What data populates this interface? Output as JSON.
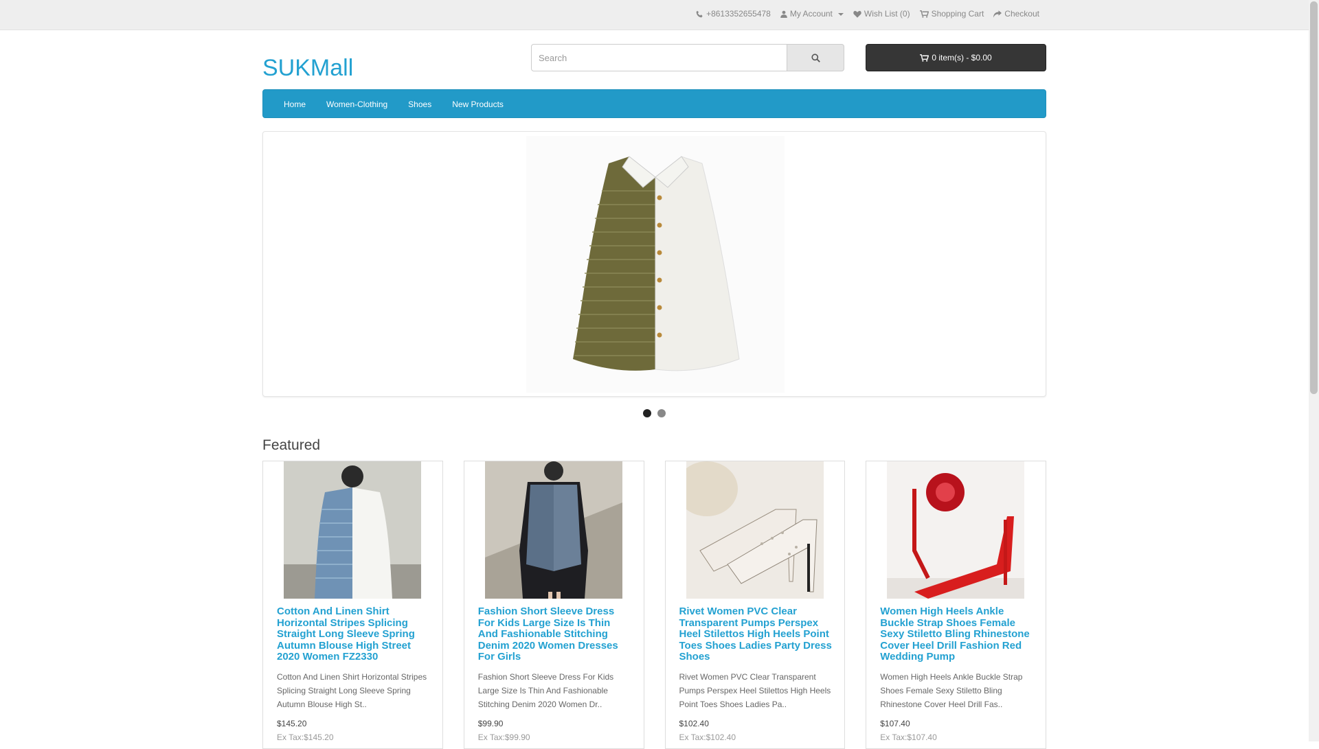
{
  "topbar": {
    "phone": "+8613352655478",
    "my_account": "My Account",
    "wishlist": "Wish List (0)",
    "shopping_cart": "Shopping Cart",
    "checkout": "Checkout"
  },
  "header": {
    "logo": "SUKMall",
    "search_placeholder": "Search",
    "cart_summary": "0 item(s) - $0.00"
  },
  "nav": {
    "items": [
      "Home",
      "Women-Clothing",
      "Shoes",
      "New Products"
    ]
  },
  "slider": {
    "slide_count": 2,
    "active_slide": 1
  },
  "featured": {
    "title": "Featured",
    "products": [
      {
        "name": "Cotton And Linen Shirt Horizontal Stripes Splicing Straight Long Sleeve Spring Autumn Blouse High Street 2020 Women FZ2330",
        "description": "Cotton And Linen Shirt Horizontal Stripes Splicing Straight Long Sleeve Spring Autumn Blouse High St..",
        "price": "$145.20",
        "ex_tax": "Ex Tax:$145.20"
      },
      {
        "name": "Fashion Short Sleeve Dress For Kids Large Size Is Thin And Fashionable Stitching Denim 2020 Women Dresses For Girls",
        "description": "Fashion Short Sleeve Dress For Kids Large Size Is Thin And Fashionable Stitching Denim 2020 Women Dr..",
        "price": "$99.90",
        "ex_tax": "Ex Tax:$99.90"
      },
      {
        "name": "Rivet Women PVC Clear Transparent Pumps Perspex Heel Stilettos High Heels Point Toes Shoes Ladies Party Dress Shoes",
        "description": "Rivet Women PVC Clear Transparent Pumps Perspex Heel Stilettos High Heels Point Toes Shoes Ladies Pa..",
        "price": "$102.40",
        "ex_tax": "Ex Tax:$102.40"
      },
      {
        "name": "Women High Heels Ankle Buckle Strap Shoes Female Sexy Stiletto Bling Rhinestone Cover Heel Drill Fashion Red Wedding Pump",
        "description": "Women High Heels Ankle Buckle Strap Shoes Female Sexy Stiletto Bling Rhinestone Cover Heel Drill Fas..",
        "price": "$107.40",
        "ex_tax": "Ex Tax:$107.40"
      }
    ]
  },
  "colors": {
    "brand": "#23a1d1",
    "nav_bg": "#229ac8",
    "cart_btn": "#363636"
  }
}
